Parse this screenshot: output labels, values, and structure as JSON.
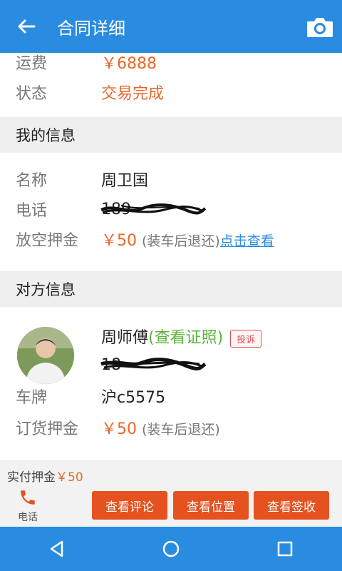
{
  "header": {
    "title": "合同详细"
  },
  "summary": {
    "freight_label": "运费",
    "freight_value": "￥6888",
    "status_label": "状态",
    "status_value": "交易完成"
  },
  "my_info": {
    "section_title": "我的信息",
    "name_label": "名称",
    "name_value": "周卫国",
    "phone_label": "电话",
    "phone_value": "189",
    "deposit_label": "放空押金",
    "deposit_value": "￥50",
    "deposit_note": "(装车后退还)",
    "deposit_link": "点击查看"
  },
  "other_info": {
    "section_title": "对方信息",
    "name": "周师傅",
    "view_cert": "(查看证照)",
    "complain": "投诉",
    "phone_value": "18",
    "plate_label": "车牌",
    "plate_value": "沪c5575",
    "order_deposit_label": "订货押金",
    "order_deposit_value": "￥50",
    "order_deposit_note": "(装车后退还)"
  },
  "bottom_bar": {
    "paid_label": "实付押金",
    "paid_value": "￥50",
    "phone_label": "电话",
    "btn_review": "查看评论",
    "btn_location": "查看位置",
    "btn_sign": "查看签收"
  },
  "colors": {
    "primary": "#2a8ce0",
    "accent": "#e6682d",
    "button": "#e5521f",
    "link_green": "#5bb33a"
  }
}
